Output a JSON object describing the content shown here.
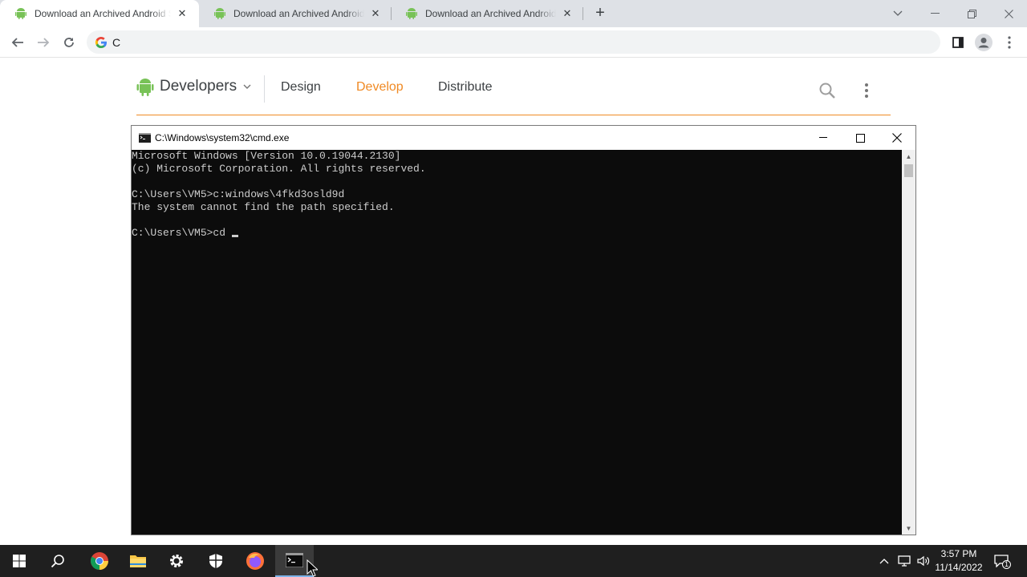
{
  "browser": {
    "tabs": [
      {
        "title": "Download an Archived Android S",
        "active": true
      },
      {
        "title": "Download an Archived Android S",
        "active": false
      },
      {
        "title": "Download an Archived Android S",
        "active": false
      }
    ],
    "new_tab_label": "+",
    "omnibox_text": "C"
  },
  "site": {
    "brand": "Developers",
    "nav": [
      {
        "label": "Design"
      },
      {
        "label": "Develop",
        "active": true
      },
      {
        "label": "Distribute"
      }
    ],
    "accent_color": "#f08a24"
  },
  "cmd": {
    "title": "C:\\Windows\\system32\\cmd.exe",
    "lines": [
      "Microsoft Windows [Version 10.0.19044.2130]",
      "(c) Microsoft Corporation. All rights reserved.",
      "",
      "C:\\Users\\VM5>c:windows\\4fkd3osld9d",
      "The system cannot find the path specified.",
      "",
      "C:\\Users\\VM5>cd"
    ]
  },
  "taskbar": {
    "apps": [
      "windows-start-icon",
      "search-icon",
      "chrome-icon",
      "file-explorer-icon",
      "settings-icon",
      "security-icon",
      "firefox-icon",
      "cmd-icon"
    ],
    "active_app": "cmd-icon",
    "time": "3:57 PM",
    "date": "11/14/2022",
    "notification_count": "1"
  }
}
